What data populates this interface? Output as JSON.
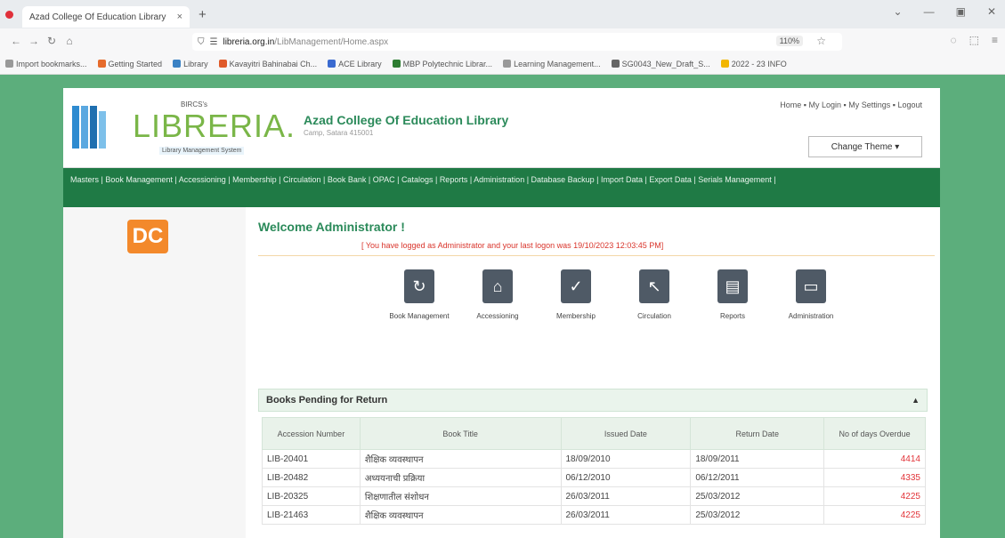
{
  "browser": {
    "tab_title": "Azad College Of Education Library",
    "tab_close": "×",
    "new_tab": "+",
    "url_host": "libreria.org.in",
    "url_path": "/LibManagement/Home.aspx",
    "zoom": "110%",
    "bookmarks": [
      {
        "label": "Import bookmarks...",
        "color": "#999999"
      },
      {
        "label": "Getting Started",
        "color": "#e66b2c"
      },
      {
        "label": "Library",
        "color": "#3b82c4"
      },
      {
        "label": "Kavayitri Bahinabai Ch...",
        "color": "#e05a2a"
      },
      {
        "label": "ACE Library",
        "color": "#3a6ad0"
      },
      {
        "label": "MBP Polytechnic Librar...",
        "color": "#2e7d32"
      },
      {
        "label": "Learning Management...",
        "color": "#999999"
      },
      {
        "label": "SG0043_New_Draft_S...",
        "color": "#666666"
      },
      {
        "label": "2022 - 23 INFO",
        "color": "#f2b600"
      }
    ]
  },
  "header": {
    "logo_small": "BIRCS's",
    "logo_text": "LIBRERIA.",
    "logo_sub": "Library Management System",
    "college_name": "Azad College Of Education Library",
    "college_place": "Camp, Satara 415001",
    "top_links": [
      "Home",
      "My Login",
      "My Settings",
      "Logout"
    ],
    "theme_button": "Change Theme ▾"
  },
  "menu_items": [
    "Masters",
    "Book Management",
    "Accessioning",
    "Membership",
    "Circulation",
    "Book Bank",
    "OPAC",
    "Catalogs",
    "Reports",
    "Administration",
    "Database Backup",
    "Import Data",
    "Export Data",
    "Serials Management"
  ],
  "sidebar": {
    "badge": "DC"
  },
  "content": {
    "welcome": "Welcome Administrator !",
    "last_login": "[ You have logged as Administrator and your last logon was 19/10/2023 12:03:45 PM]"
  },
  "modules": [
    {
      "label": "Book Management",
      "icon": "book-icon"
    },
    {
      "label": "Accessioning",
      "icon": "home-icon"
    },
    {
      "label": "Membership",
      "icon": "check-icon"
    },
    {
      "label": "Circulation",
      "icon": "pointer-icon"
    },
    {
      "label": "Reports",
      "icon": "document-icon"
    },
    {
      "label": "Administration",
      "icon": "window-icon"
    }
  ],
  "pending": {
    "title": "Books Pending for Return",
    "columns": [
      "Accession Number",
      "Book Title",
      "Issued Date",
      "Return Date",
      "No of days Overdue"
    ],
    "rows": [
      [
        "LIB-20401",
        "शैक्षिक व्यवस्थापन",
        "18/09/2010",
        "18/09/2011",
        "4414"
      ],
      [
        "LIB-20482",
        "अध्ययनाची प्रक्रिया",
        "06/12/2010",
        "06/12/2011",
        "4335"
      ],
      [
        "LIB-20325",
        "शिक्षणातील संशोधन",
        "26/03/2011",
        "25/03/2012",
        "4225"
      ],
      [
        "LIB-21463",
        "शैक्षिक व्यवस्थापन",
        "26/03/2011",
        "25/03/2012",
        "4225"
      ]
    ]
  },
  "colors": {
    "accent": "#1f7a45",
    "title": "#2b8a5a",
    "overdue": "#e2353a",
    "background": "#5cae7c"
  }
}
